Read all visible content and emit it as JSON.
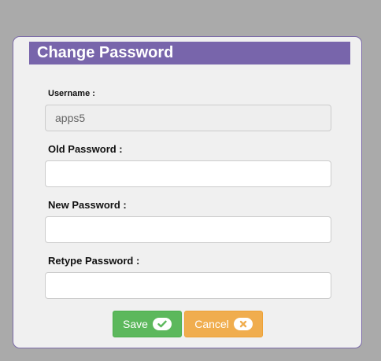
{
  "dialog": {
    "title": "Change Password"
  },
  "form": {
    "username_label": "Username :",
    "username_value": "apps5",
    "old_password_label": "Old Password :",
    "old_password_value": "",
    "new_password_label": "New Password :",
    "new_password_value": "",
    "retype_password_label": "Retype Password :",
    "retype_password_value": ""
  },
  "buttons": {
    "save_label": "Save",
    "save_icon": "check-icon",
    "cancel_label": "Cancel",
    "cancel_icon": "close-icon"
  },
  "colors": {
    "backdrop": "#aaaaaa",
    "title_bar": "#7865ab",
    "save": "#5cb85c",
    "cancel": "#f0ad4e"
  }
}
